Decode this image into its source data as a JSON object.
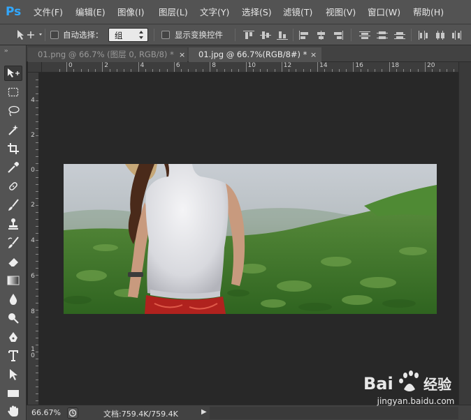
{
  "app": {
    "logo_text": "Ps"
  },
  "menu": {
    "items": [
      {
        "label": "文件(F)"
      },
      {
        "label": "编辑(E)"
      },
      {
        "label": "图像(I)"
      },
      {
        "label": "图层(L)"
      },
      {
        "label": "文字(Y)"
      },
      {
        "label": "选择(S)"
      },
      {
        "label": "滤镜(T)"
      },
      {
        "label": "视图(V)"
      },
      {
        "label": "窗口(W)"
      },
      {
        "label": "帮助(H)"
      }
    ]
  },
  "options": {
    "auto_select_label": "自动选择：",
    "auto_select_value": "组",
    "show_transform_label": "显示变换控件",
    "dropdown_arrows": "▲▼"
  },
  "tabs": [
    {
      "label": "01.png @ 66.7% (图层 0, RGB/8) *",
      "close": "×",
      "active": false
    },
    {
      "label": "01.jpg @ 66.7%(RGB/8#) *",
      "close": "×",
      "active": true
    }
  ],
  "ruler": {
    "h_labels": [
      "0",
      "2",
      "4",
      "6",
      "8",
      "10",
      "12",
      "14",
      "16",
      "18",
      "20",
      "2"
    ],
    "v_labels": [
      "4",
      "2",
      "0",
      "2",
      "4",
      "6",
      "8",
      "1\n0"
    ]
  },
  "toolbar": {
    "collapse_label": "››"
  },
  "status": {
    "zoom": "66.67%",
    "doc_info": "文档:759.4K/759.4K",
    "arrow": "▶"
  },
  "watermark": {
    "text": "jingyan.baidu.com",
    "logo": "Bai  经验"
  }
}
